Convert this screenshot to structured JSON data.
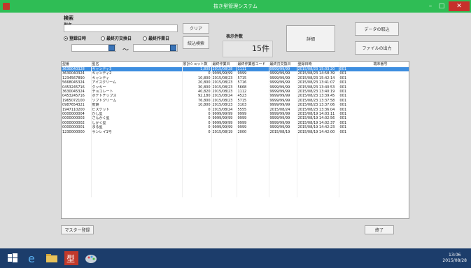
{
  "window": {
    "title": "抜き型管理システム"
  },
  "search": {
    "section_label": "検索",
    "type_label": "型名",
    "type_value": "",
    "radios": [
      {
        "label": "登録日時",
        "checked": true
      },
      {
        "label": "最終刃交換日",
        "checked": false
      },
      {
        "label": "最終作業日",
        "checked": false
      }
    ],
    "date_from": "",
    "date_to": "",
    "tilde": "～",
    "clear_label": "クリア",
    "refine_label": "絞込検索",
    "count_label": "表示件数",
    "count_value": "15件",
    "detail_label": "詳細",
    "import_label": "データの取込",
    "export_label": "ファイルの出力"
  },
  "table": {
    "columns": [
      "型番",
      "型名",
      "累計ショット数",
      "最終作業日",
      "最終作業者コード",
      "最終刃交換日",
      "登録日時",
      "端末番号"
    ],
    "rows": [
      [
        "3630040328",
        "キャンディ3",
        "1,800",
        "2015/08/28",
        "1111",
        "9999/99/99",
        "2015/08/23 15:03:20",
        "001"
      ],
      [
        "3630040324",
        "キャンディ2",
        "0",
        "9999/99/99",
        "9999",
        "9999/99/99",
        "2015/08/23 14:58:39",
        "001"
      ],
      [
        "1234567890",
        "キャンディ",
        "10,800",
        "2015/08/23",
        "5715",
        "9999/99/99",
        "2015/08/23 15:42:14",
        "001"
      ],
      [
        "5668045324",
        "アイスクリーム",
        "20,800",
        "2015/08/23",
        "5716",
        "9999/99/99",
        "2015/08/23 13:41:07",
        "001"
      ],
      [
        "0453245716",
        "クッキー",
        "30,800",
        "2015/08/23",
        "5668",
        "9999/99/99",
        "2015/08/23 13:40:53",
        "001"
      ],
      [
        "3630045324",
        "チョコレート",
        "40,820",
        "2015/08/23",
        "1112",
        "9999/99/99",
        "2015/08/23 13:40:19",
        "001"
      ],
      [
        "0453245716",
        "ポテトチップス",
        "92,180",
        "2015/08/24",
        "4523",
        "9999/99/99",
        "2015/08/23 13:39:45",
        "001"
      ],
      [
        "1965072100",
        "ソフトクリーム",
        "76,800",
        "2015/08/23",
        "5715",
        "9999/99/99",
        "2015/08/23 13:37:58",
        "001"
      ],
      [
        "0987654321",
        "煎餅",
        "10,800",
        "2015/08/23",
        "3103",
        "9999/99/99",
        "2015/08/23 13:37:06",
        "001"
      ],
      [
        "1947110200",
        "ビスケット",
        "0",
        "2015/08/24",
        "5555",
        "2015/08/24",
        "2015/08/23 13:36:04",
        "001"
      ],
      [
        "0000000004",
        "ひし型",
        "0",
        "9999/99/99",
        "9999",
        "9999/99/99",
        "2015/08/19 14:03:11",
        "001"
      ],
      [
        "0000000003",
        "さんかく型",
        "0",
        "9999/99/99",
        "9999",
        "9999/99/99",
        "2015/08/19 14:02:56",
        "001"
      ],
      [
        "0000000002",
        "しかく型",
        "0",
        "9999/99/99",
        "9999",
        "9999/99/99",
        "2015/08/19 14:02:37",
        "001"
      ],
      [
        "0000000001",
        "まる型",
        "0",
        "9999/99/99",
        "9999",
        "9999/99/99",
        "2015/08/19 14:42:23",
        "001"
      ],
      [
        "1230000000",
        "サンレイ1号",
        "0",
        "2015/08/19",
        "2000",
        "2015/08/19",
        "2015/08/19 14:42:00",
        "001"
      ]
    ],
    "selected_row": 0,
    "empty_rows": 14
  },
  "footer": {
    "master_label": "マスター登録",
    "exit_label": "終了"
  },
  "taskbar": {
    "icons": [
      "windows-start-icon",
      "ie-icon",
      "file-explorer-icon",
      "app-kata-icon",
      "paint-icon"
    ],
    "time": "13:06",
    "date": "2015/08/28"
  },
  "colors": {
    "titlebar": "#2fbd55",
    "selection": "#3d8ee0",
    "taskbar": "#1c3d6b"
  }
}
